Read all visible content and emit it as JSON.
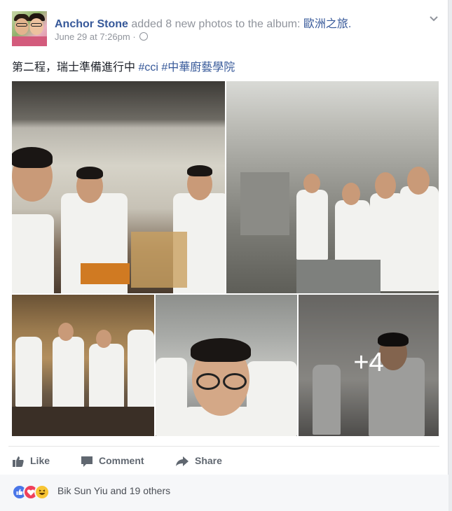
{
  "post": {
    "author": "Anchor Stone",
    "action_text": "added 8 new photos to the album:",
    "album_name": "歐洲之旅.",
    "timestamp": "June 29 at 7:26pm",
    "audience_icon": "globe-icon",
    "text_plain": "第二程，瑞士準備進行中",
    "hashtags": [
      "#cci",
      "#中華廚藝學院"
    ],
    "more_photos_label": "+4"
  },
  "actions": {
    "like": "Like",
    "comment": "Comment",
    "share": "Share"
  },
  "reactions": {
    "icons": [
      "like-reaction-icon",
      "love-reaction-icon",
      "haha-reaction-icon"
    ],
    "summary": "Bik Sun Yiu and 19 others"
  },
  "colors": {
    "link": "#365899",
    "secondary_text": "#90949c",
    "action_text": "#606770",
    "like_blue": "#4a76e8",
    "love_red": "#f0405b",
    "haha_yellow": "#f7c534"
  }
}
